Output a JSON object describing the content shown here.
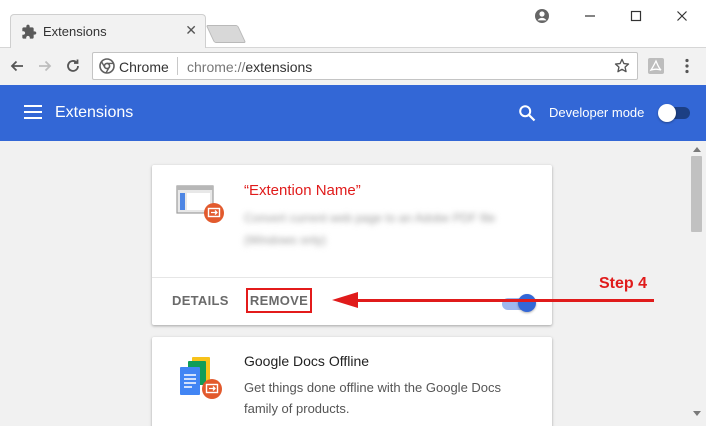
{
  "browser": {
    "tab_title": "Extensions",
    "omnibox_site": "Chrome",
    "omnibox_url_scheme": "chrome://",
    "omnibox_url_path": "extensions"
  },
  "header": {
    "title": "Extensions",
    "developer_mode_label": "Developer mode",
    "developer_mode_on": false,
    "color": "#3367d6"
  },
  "extensions": [
    {
      "name": "“Extention Name”",
      "description_line1": "Convert current web page to an Adobe PDF file",
      "description_line2": "(Windows only)",
      "details_label": "DETAILS",
      "remove_label": "REMOVE",
      "enabled": true
    },
    {
      "name": "Google Docs Offline",
      "description_line1": "Get things done offline with the Google Docs",
      "description_line2": "family of products."
    }
  ],
  "annotation": {
    "label": "Step 4",
    "color": "#e01b1b"
  }
}
